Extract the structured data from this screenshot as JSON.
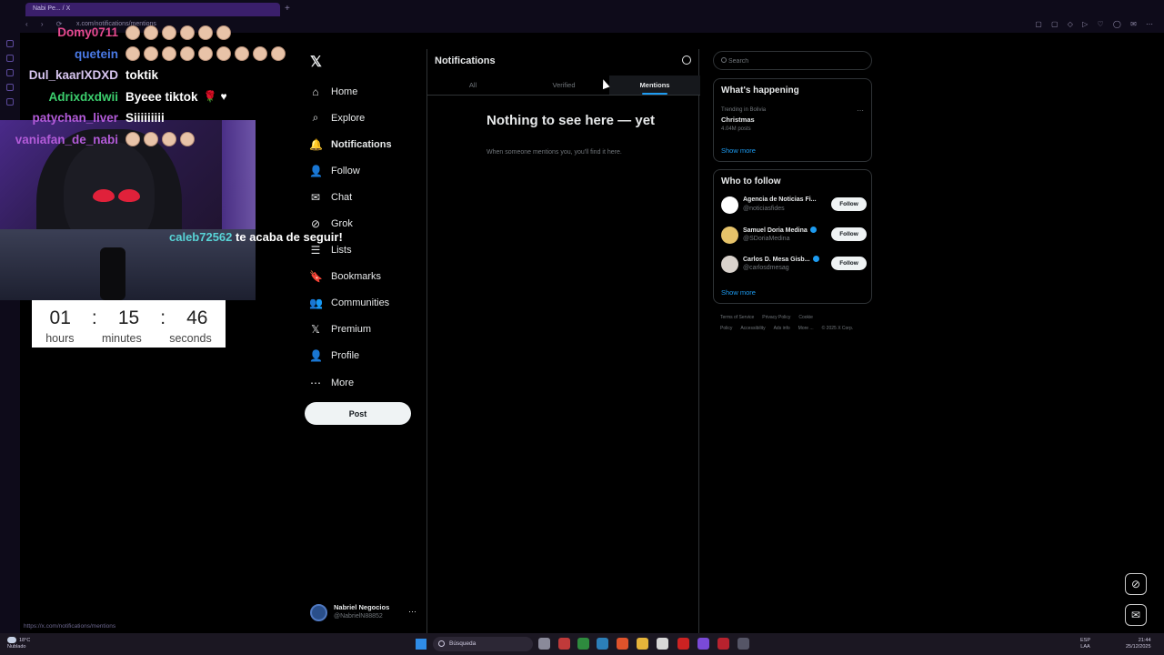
{
  "browser": {
    "tab_title": "Nabi Pe... / X",
    "url": "x.com/notifications/mentions",
    "status_url": "https://x.com/notifications/mentions"
  },
  "nav": {
    "items": [
      {
        "label": "Home",
        "icon": "home-icon",
        "glyph": "⌂"
      },
      {
        "label": "Explore",
        "icon": "search-icon",
        "glyph": "⌕"
      },
      {
        "label": "Notifications",
        "icon": "bell-icon",
        "glyph": "🔔"
      },
      {
        "label": "Follow",
        "icon": "add-person-icon",
        "glyph": "👤"
      },
      {
        "label": "Chat",
        "icon": "mail-icon",
        "glyph": "✉"
      },
      {
        "label": "Grok",
        "icon": "grok-icon",
        "glyph": "⊘"
      },
      {
        "label": "Lists",
        "icon": "list-icon",
        "glyph": "☰"
      },
      {
        "label": "Bookmarks",
        "icon": "bookmark-icon",
        "glyph": "🔖"
      },
      {
        "label": "Communities",
        "icon": "communities-icon",
        "glyph": "👥"
      },
      {
        "label": "Premium",
        "icon": "x-premium-icon",
        "glyph": "𝕏"
      },
      {
        "label": "Profile",
        "icon": "profile-icon",
        "glyph": "👤"
      },
      {
        "label": "More",
        "icon": "more-circle-icon",
        "glyph": "⋯"
      }
    ],
    "post_label": "Post",
    "account_name": "Nabriel Negocios",
    "account_handle": "@NabrielN88852"
  },
  "notifications": {
    "title": "Notifications",
    "tabs": [
      "All",
      "Verified",
      "Mentions"
    ],
    "empty_title": "Nothing to see here — yet",
    "empty_sub": "When someone mentions you, you'll find it here."
  },
  "sidebar": {
    "search_placeholder": "Search",
    "happening_title": "What's happening",
    "trend_meta": "Trending in Bolivia",
    "trend_name": "Christmas",
    "trend_posts": "4.04M posts",
    "show_more": "Show more",
    "who_title": "Who to follow",
    "who": [
      {
        "name": "Agencia de Noticias Fi...",
        "handle": "@noticiasfides",
        "verified": false,
        "avatar_color": "#ffffff"
      },
      {
        "name": "Samuel Doria Medina",
        "handle": "@SDoriaMedina",
        "verified": true,
        "avatar_color": "#e6c36a"
      },
      {
        "name": "Carlos D. Mesa Gisb...",
        "handle": "@carlosdmesag",
        "verified": true,
        "avatar_color": "#d9d2cc"
      }
    ],
    "follow_label": "Follow",
    "footer": [
      "Terms of Service",
      "Privacy Policy",
      "Cookie Policy",
      "Accessibility",
      "Ads info",
      "More ...",
      "© 2025 X Corp."
    ]
  },
  "overlay": {
    "chat": [
      {
        "user": "Domy0711",
        "msg": "",
        "color": "#e64a8f",
        "emotes": 6
      },
      {
        "user": "quetein",
        "msg": "",
        "color": "#4a7ae6",
        "emotes": 9
      },
      {
        "user": "Dul_kaarIXDXD",
        "msg": "toktik",
        "color": "#d8c6f0",
        "emotes": 0
      },
      {
        "user": "Adrixdxdwii",
        "msg": "Byeee tiktok",
        "color": "#3ccf6e",
        "emotes": 0,
        "rose": true,
        "heart": true
      },
      {
        "user": "patychan_liver",
        "msg": "Siiiiiiiii",
        "color": "#b35bd9",
        "emotes": 0
      },
      {
        "user": "vaniafan_de_nabi",
        "msg": "",
        "color": "#b35bd9",
        "emotes": 4
      }
    ],
    "follow_alert_user": "caleb72562",
    "follow_alert_text": "te acaba de seguir!",
    "timer": {
      "hours": "01",
      "minutes": "15",
      "seconds": "46",
      "h_label": "hours",
      "m_label": "minutes",
      "s_label": "seconds"
    }
  },
  "taskbar": {
    "temp": "18°C",
    "weather": "Nublado",
    "search": "Búsqueda",
    "lang_top": "ESP",
    "lang_bottom": "LAA",
    "time": "21:44",
    "date": "25/12/2025"
  }
}
